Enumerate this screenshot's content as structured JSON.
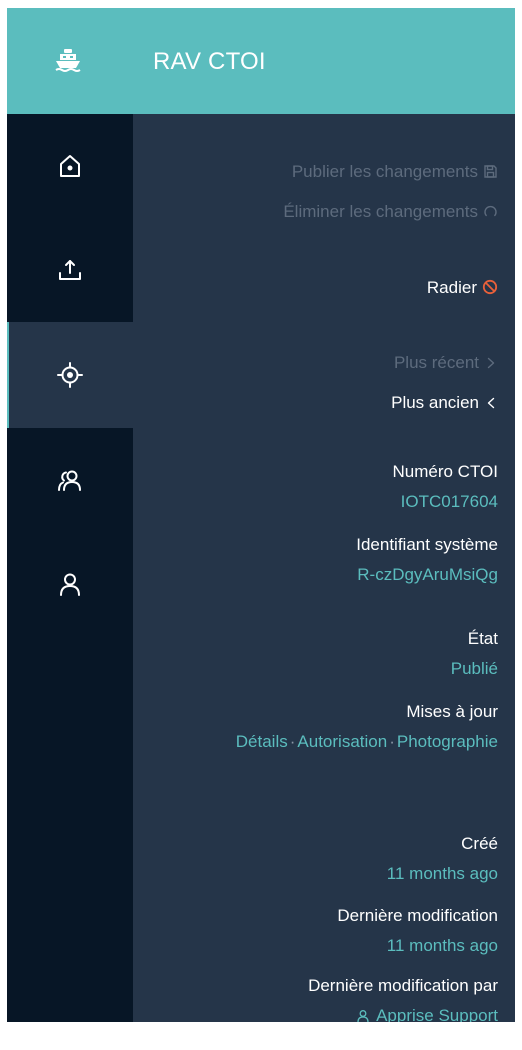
{
  "header": {
    "title": "RAV CTOI",
    "icon": "ship-icon"
  },
  "sidebar": {
    "items": [
      {
        "name": "home",
        "icon": "home-icon",
        "active": false
      },
      {
        "name": "upload",
        "icon": "upload-icon",
        "active": false
      },
      {
        "name": "locate",
        "icon": "target-icon",
        "active": true
      },
      {
        "name": "users",
        "icon": "users-icon",
        "active": false
      },
      {
        "name": "user",
        "icon": "user-icon",
        "active": false
      }
    ]
  },
  "actions": {
    "publish_label": "Publier les changements",
    "discard_label": "Éliminer les changements",
    "delist_label": "Radier",
    "newer_label": "Plus récent",
    "older_label": "Plus ancien"
  },
  "details": {
    "ctoi_number_label": "Numéro CTOI",
    "ctoi_number_value": "IOTC017604",
    "system_id_label": "Identifiant système",
    "system_id_value": "R-czDgyAruMsiQg",
    "state_label": "État",
    "state_value": "Publié",
    "updates_label": "Mises à jour",
    "updates": [
      "Détails",
      "Autorisation",
      "Photographie"
    ],
    "created_label": "Créé",
    "created_value": "11 months ago",
    "modified_label": "Dernière modification",
    "modified_value": "11 months ago",
    "modified_by_label": "Dernière modification par",
    "modified_by_value": "Apprise Support"
  },
  "colors": {
    "accent": "#5bbdbe",
    "sidebar": "#071626",
    "panel": "#253549",
    "danger": "#e8603a"
  }
}
